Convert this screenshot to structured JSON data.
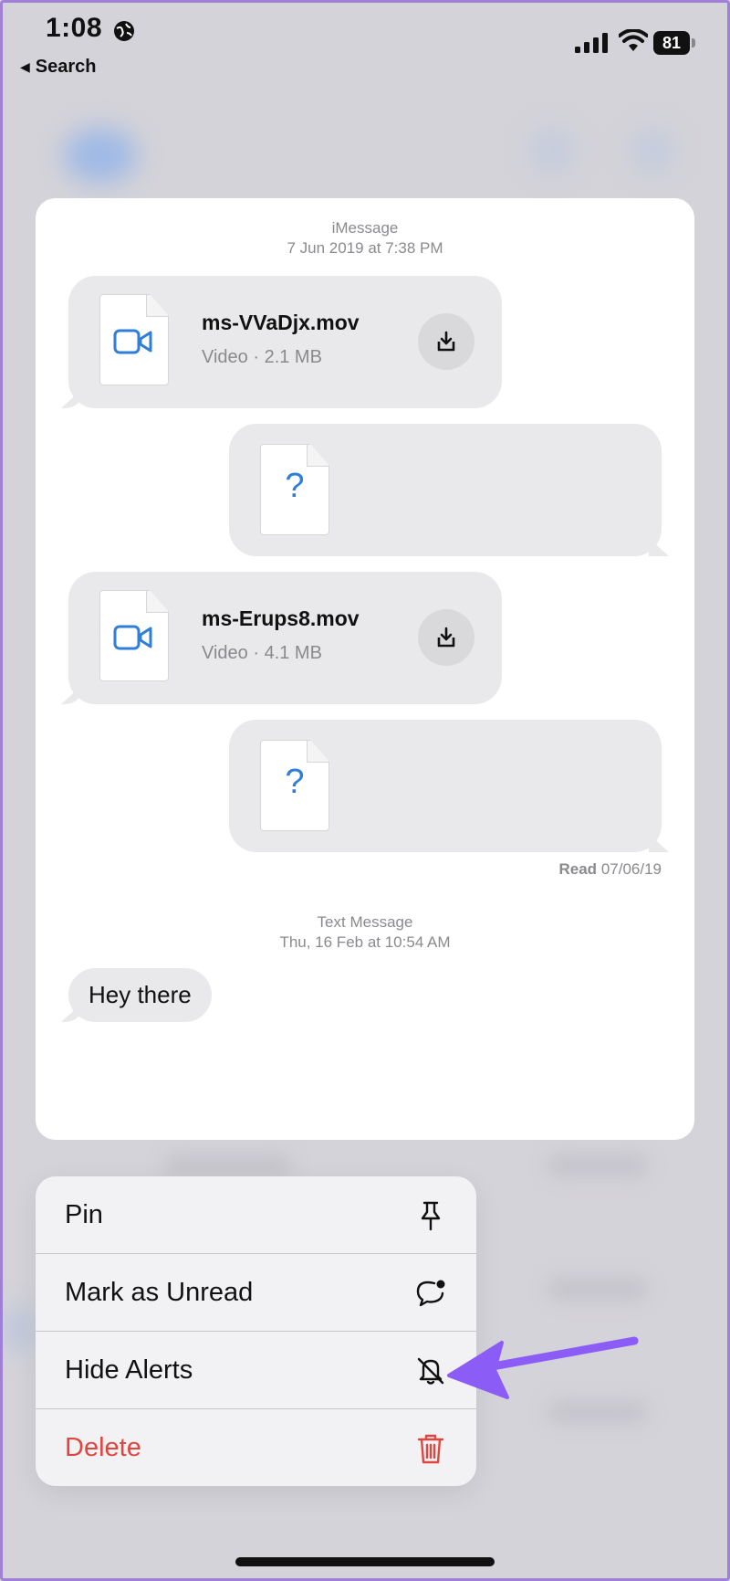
{
  "status_bar": {
    "time": "1:08",
    "battery": "81",
    "back_label": "Search"
  },
  "conversation": {
    "header_1": {
      "service": "iMessage",
      "timestamp": "7 Jun 2019 at 7:38 PM"
    },
    "attachments": [
      {
        "name": "ms-VVaDjx.mov",
        "details": "Video · 2.1 MB"
      },
      {
        "name": "ms-Erups8.mov",
        "details": "Video · 4.1 MB"
      }
    ],
    "unknown_glyph": "?",
    "read_label": "Read",
    "read_date": "07/06/19",
    "header_2": {
      "service": "Text Message",
      "timestamp": "Thu, 16 Feb at 10:54 AM"
    },
    "last_message": "Hey there"
  },
  "context_menu": {
    "items": [
      {
        "label": "Pin",
        "icon": "pin-icon"
      },
      {
        "label": "Mark as Unread",
        "icon": "unread-bubble-icon"
      },
      {
        "label": "Hide Alerts",
        "icon": "bell-slash-icon"
      },
      {
        "label": "Delete",
        "icon": "trash-icon"
      }
    ]
  },
  "colors": {
    "accent": "#2f7ed8",
    "destructive": "#e0463f",
    "annotation_arrow": "#8b5cf6"
  }
}
